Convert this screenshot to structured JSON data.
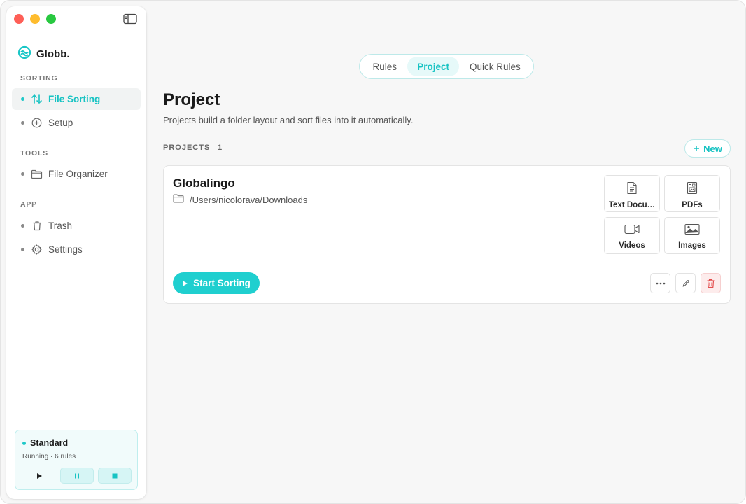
{
  "app": {
    "name": "Globb."
  },
  "colors": {
    "accent": "#1fcfcf",
    "accent_text": "#17c3c3",
    "danger": "#e34c4c"
  },
  "sidebar": {
    "sections": [
      {
        "label": "SORTING",
        "items": [
          {
            "label": "File Sorting",
            "icon": "sort-arrows-icon",
            "active": true
          },
          {
            "label": "Setup",
            "icon": "plus-circle-icon",
            "active": false
          }
        ]
      },
      {
        "label": "TOOLS",
        "items": [
          {
            "label": "File Organizer",
            "icon": "folder-icon",
            "active": false
          }
        ]
      },
      {
        "label": "APP",
        "items": [
          {
            "label": "Trash",
            "icon": "trash-icon",
            "active": false
          },
          {
            "label": "Settings",
            "icon": "gear-icon",
            "active": false
          }
        ]
      }
    ],
    "status": {
      "title": "Standard",
      "subtitle": "Running · 6 rules"
    }
  },
  "tabs": [
    {
      "label": "Rules",
      "active": false
    },
    {
      "label": "Project",
      "active": true
    },
    {
      "label": "Quick Rules",
      "active": false
    }
  ],
  "page": {
    "title": "Project",
    "subtitle": "Projects build a folder layout and sort files into it automatically."
  },
  "projects": {
    "label": "PROJECTS",
    "count": "1",
    "new_label": "New",
    "items": [
      {
        "name": "Globalingo",
        "path": "/Users/nicolorava/Downloads",
        "categories": [
          {
            "label": "Text Docu…",
            "icon": "document-icon"
          },
          {
            "label": "PDFs",
            "icon": "pdf-icon"
          },
          {
            "label": "Videos",
            "icon": "video-icon"
          },
          {
            "label": "Images",
            "icon": "image-icon"
          }
        ],
        "start_label": "Start Sorting"
      }
    ]
  }
}
